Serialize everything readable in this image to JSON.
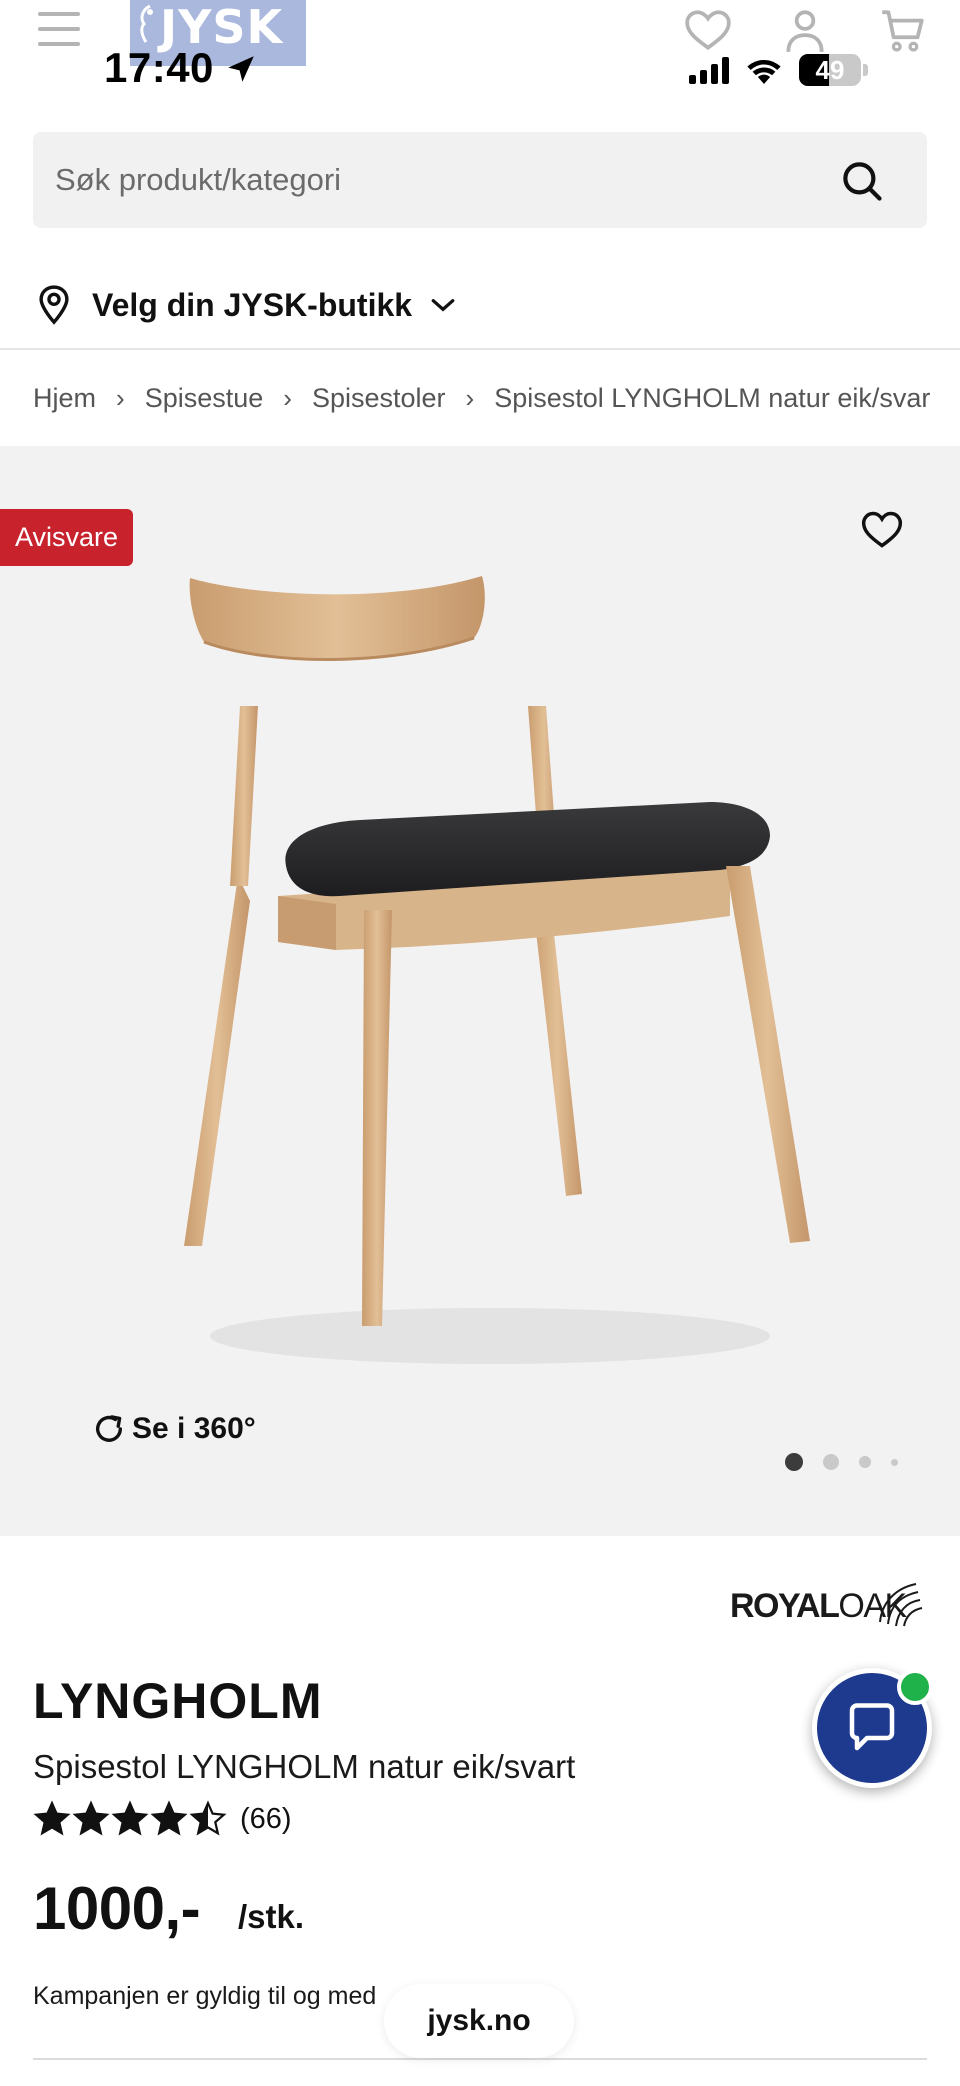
{
  "status_bar": {
    "time": "17:40",
    "battery": "49",
    "battery_level": 0.49
  },
  "header": {
    "logo": "JYSK"
  },
  "search": {
    "placeholder": "Søk produkt/kategori"
  },
  "store": {
    "label": "Velg din JYSK-butikk"
  },
  "breadcrumb": [
    "Hjem",
    "Spisestue",
    "Spisestoler",
    "Spisestol LYNGHOLM natur eik/svar"
  ],
  "gallery": {
    "badge": "Avisvare",
    "rotate_label": "Se i 360°",
    "slide_count": 4,
    "active_slide": 1
  },
  "product": {
    "brand_part1": "ROYAL",
    "brand_part2": "OAK",
    "name": "LYNGHOLM",
    "description": "Spisestol LYNGHOLM natur eik/svart",
    "rating_value": 4.5,
    "rating_max": 5,
    "rating_count": "(66)",
    "price": "1000,-",
    "unit": "/stk.",
    "campaign": "Kampanjen er gyldig til og med"
  },
  "browser": {
    "url": "jysk.no"
  },
  "colors": {
    "badge": "#c8232d",
    "chat_button": "#1d3a8f",
    "online_dot": "#1fb14a",
    "gallery_bg": "#f3f2f3"
  }
}
